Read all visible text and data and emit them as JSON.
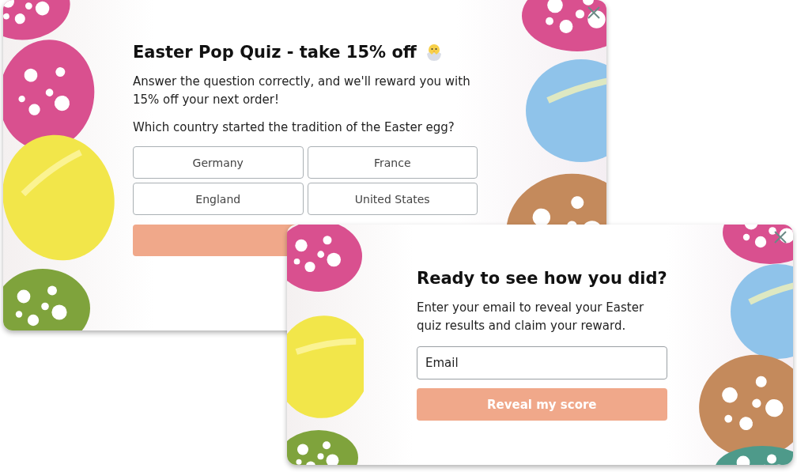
{
  "quiz_popup": {
    "title": "Easter Pop Quiz - take 15% off",
    "intro": "Answer the question correctly, and we'll reward you with 15% off your next order!",
    "question": "Which country started the tradition of the Easter egg?",
    "answers": [
      {
        "label": "Germany"
      },
      {
        "label": "France"
      },
      {
        "label": "England"
      },
      {
        "label": "United States"
      }
    ]
  },
  "email_popup": {
    "title": "Ready to see how you did?",
    "intro": "Enter your email to reveal your Easter quiz results and claim your reward.",
    "email_field": {
      "placeholder": "Email"
    },
    "button": "Reveal my score"
  }
}
